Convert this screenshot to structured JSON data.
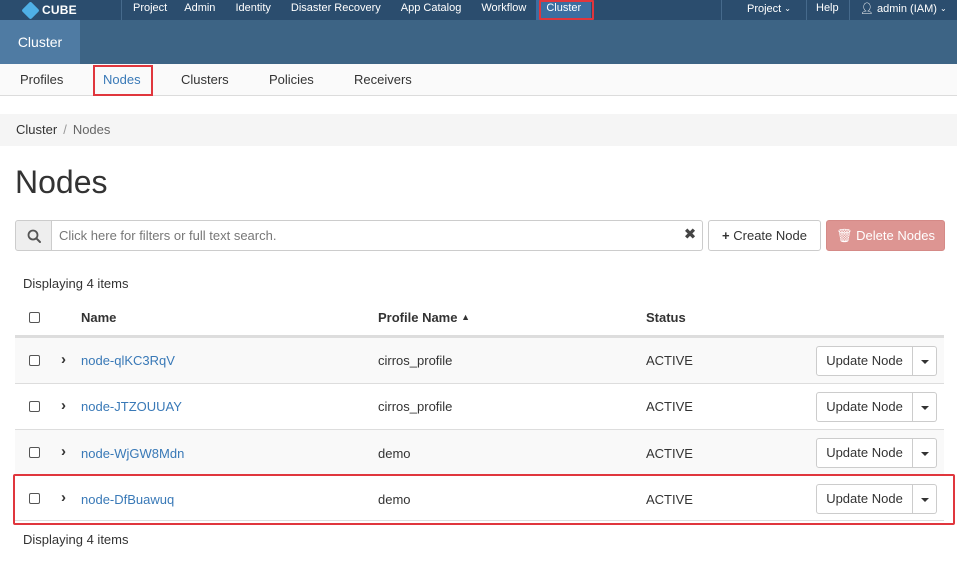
{
  "topbar": {
    "brand": "CUBE",
    "nav": [
      {
        "label": "Project"
      },
      {
        "label": "Admin"
      },
      {
        "label": "Identity"
      },
      {
        "label": "Disaster Recovery"
      },
      {
        "label": "App Catalog"
      },
      {
        "label": "Workflow"
      },
      {
        "label": "Cluster"
      }
    ],
    "right": {
      "project_label": "Project",
      "help_label": "Help",
      "user_label": "admin (IAM)"
    }
  },
  "band": {
    "active_tab": "Cluster"
  },
  "tabs": [
    {
      "label": "Profiles"
    },
    {
      "label": "Nodes"
    },
    {
      "label": "Clusters"
    },
    {
      "label": "Policies"
    },
    {
      "label": "Receivers"
    }
  ],
  "breadcrumb": {
    "parent": "Cluster",
    "separator": "/",
    "current": "Nodes"
  },
  "page_title": "Nodes",
  "search": {
    "placeholder": "Click here for filters or full text search."
  },
  "actions": {
    "create_label": "Create Node",
    "delete_label": "Delete Nodes"
  },
  "count_text": "Displaying 4 items",
  "table": {
    "headers": {
      "name": "Name",
      "profile": "Profile Name",
      "status": "Status"
    },
    "rows": [
      {
        "name": "node-qlKC3RqV",
        "profile": "cirros_profile",
        "status": "ACTIVE",
        "action": "Update Node"
      },
      {
        "name": "node-JTZOUUAY",
        "profile": "cirros_profile",
        "status": "ACTIVE",
        "action": "Update Node"
      },
      {
        "name": "node-WjGW8Mdn",
        "profile": "demo",
        "status": "ACTIVE",
        "action": "Update Node"
      },
      {
        "name": "node-DfBuawuq",
        "profile": "demo",
        "status": "ACTIVE",
        "action": "Update Node"
      }
    ]
  }
}
